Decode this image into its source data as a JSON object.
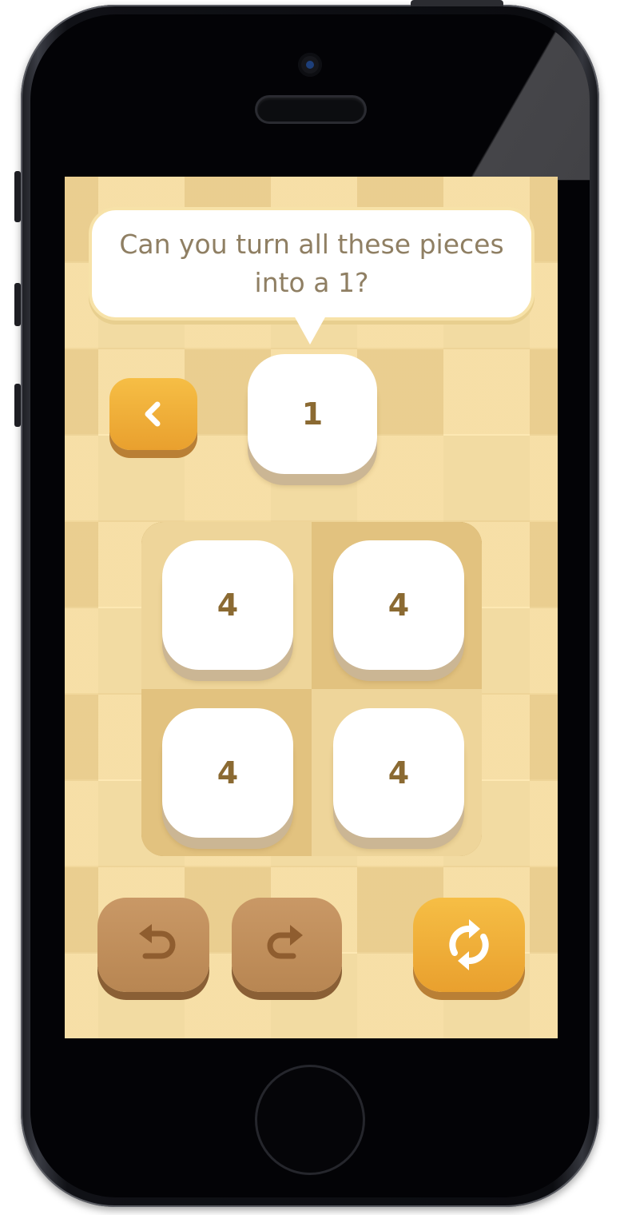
{
  "prompt": {
    "text": "Can you turn all these pieces into a 1?"
  },
  "target": {
    "value": "1"
  },
  "board": {
    "rows": 2,
    "cols": 2,
    "tiles": [
      "4",
      "4",
      "4",
      "4"
    ]
  },
  "controls": {
    "back_icon": "chevron-left-icon",
    "undo_icon": "undo-arrow-icon",
    "redo_icon": "redo-arrow-icon",
    "restart_icon": "restart-cycle-icon"
  },
  "colors": {
    "background_light": "#fde8b3",
    "background_dark": "#f2dba2",
    "accent_orange": "#f0b03b",
    "button_brown": "#c08f5b",
    "tile_text": "#8b6a32",
    "prompt_text": "#8f7f63"
  }
}
